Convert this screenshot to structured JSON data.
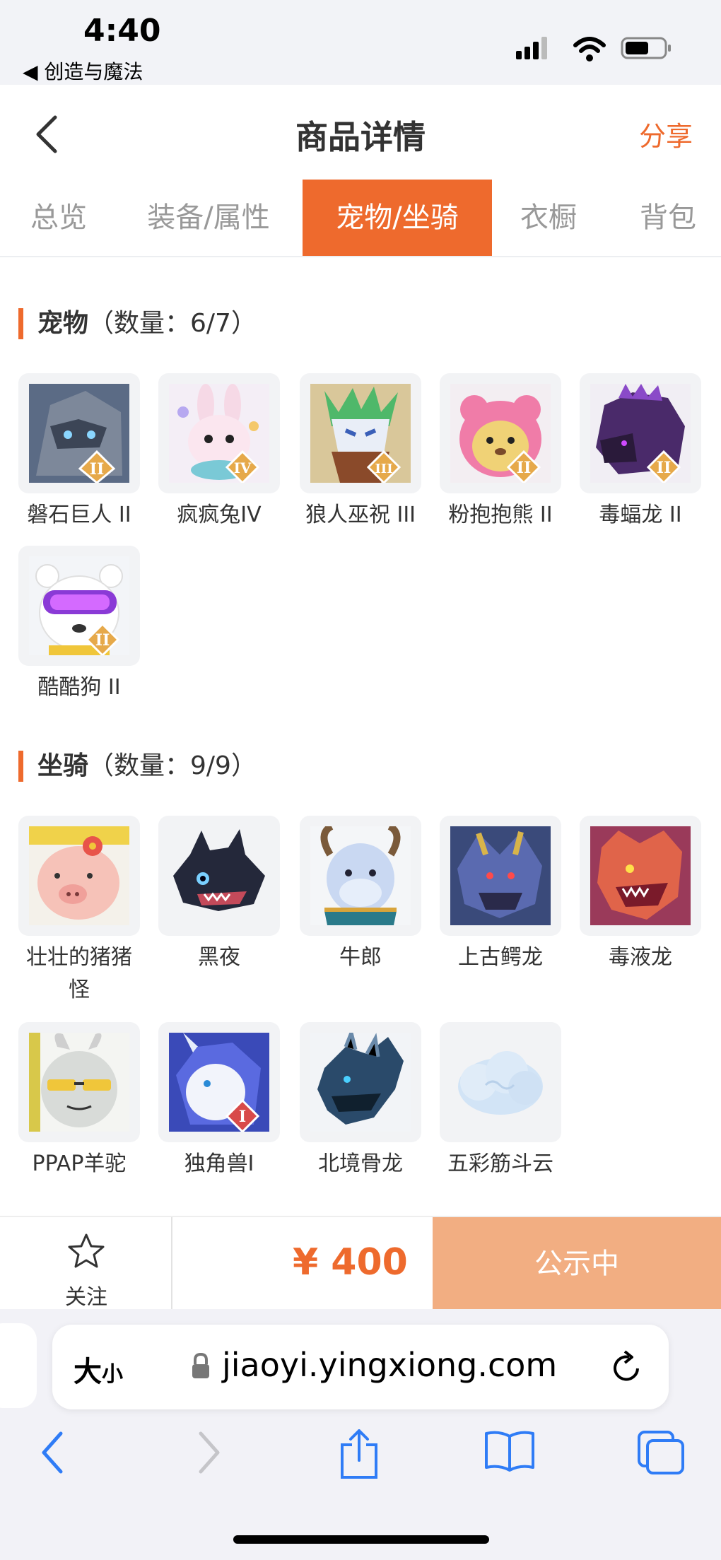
{
  "status_bar": {
    "time": "4:40",
    "back_app": "◀ 创造与魔法"
  },
  "header": {
    "title": "商品详情",
    "share": "分享"
  },
  "tabs": [
    {
      "label": "总览",
      "active": false
    },
    {
      "label": "装备/属性",
      "active": false
    },
    {
      "label": "宠物/坐骑",
      "active": true
    },
    {
      "label": "衣橱",
      "active": false
    },
    {
      "label": "背包",
      "active": false
    }
  ],
  "pets_section": {
    "title": "宠物",
    "count": "（数量：6/7）"
  },
  "pets": [
    {
      "name": "磐石巨人 II",
      "icon": "stone-giant-icon",
      "badge": "II"
    },
    {
      "name": "疯疯兔IV",
      "icon": "crazy-rabbit-icon",
      "badge": "IV"
    },
    {
      "name": "狼人巫祝 III",
      "icon": "werewolf-shaman-icon",
      "badge": "III"
    },
    {
      "name": "粉抱抱熊 II",
      "icon": "pink-bear-icon",
      "badge": "II"
    },
    {
      "name": "毒蝠龙 II",
      "icon": "poison-bat-dragon-icon",
      "badge": "II"
    },
    {
      "name": "酷酷狗 II",
      "icon": "cool-dog-icon",
      "badge": "II"
    }
  ],
  "mounts_section": {
    "title": "坐骑",
    "count": "（数量：9/9）"
  },
  "mounts": [
    {
      "name": "壮壮的猪猪怪",
      "icon": "pig-monster-icon",
      "badge": ""
    },
    {
      "name": "黑夜",
      "icon": "black-night-dragon-icon",
      "badge": ""
    },
    {
      "name": "牛郎",
      "icon": "cowherd-icon",
      "badge": ""
    },
    {
      "name": "上古鳄龙",
      "icon": "ancient-croc-dragon-icon",
      "badge": ""
    },
    {
      "name": "毒液龙",
      "icon": "venom-dragon-icon",
      "badge": ""
    },
    {
      "name": "PPAP羊驼",
      "icon": "ppap-alpaca-icon",
      "badge": ""
    },
    {
      "name": "独角兽I",
      "icon": "unicorn-icon",
      "badge": "I"
    },
    {
      "name": "北境骨龙",
      "icon": "northern-bone-dragon-icon",
      "badge": ""
    },
    {
      "name": "五彩筋斗云",
      "icon": "rainbow-cloud-icon",
      "badge": ""
    }
  ],
  "bottom": {
    "follow": "关注",
    "price": "¥ 400",
    "status": "公示中"
  },
  "browser": {
    "text_size": "大",
    "text_size_small": "小",
    "url": "jiaoyi.yingxiong.com"
  },
  "colors": {
    "accent": "#ee6a2d",
    "publicity_bg": "#f2ae82"
  }
}
